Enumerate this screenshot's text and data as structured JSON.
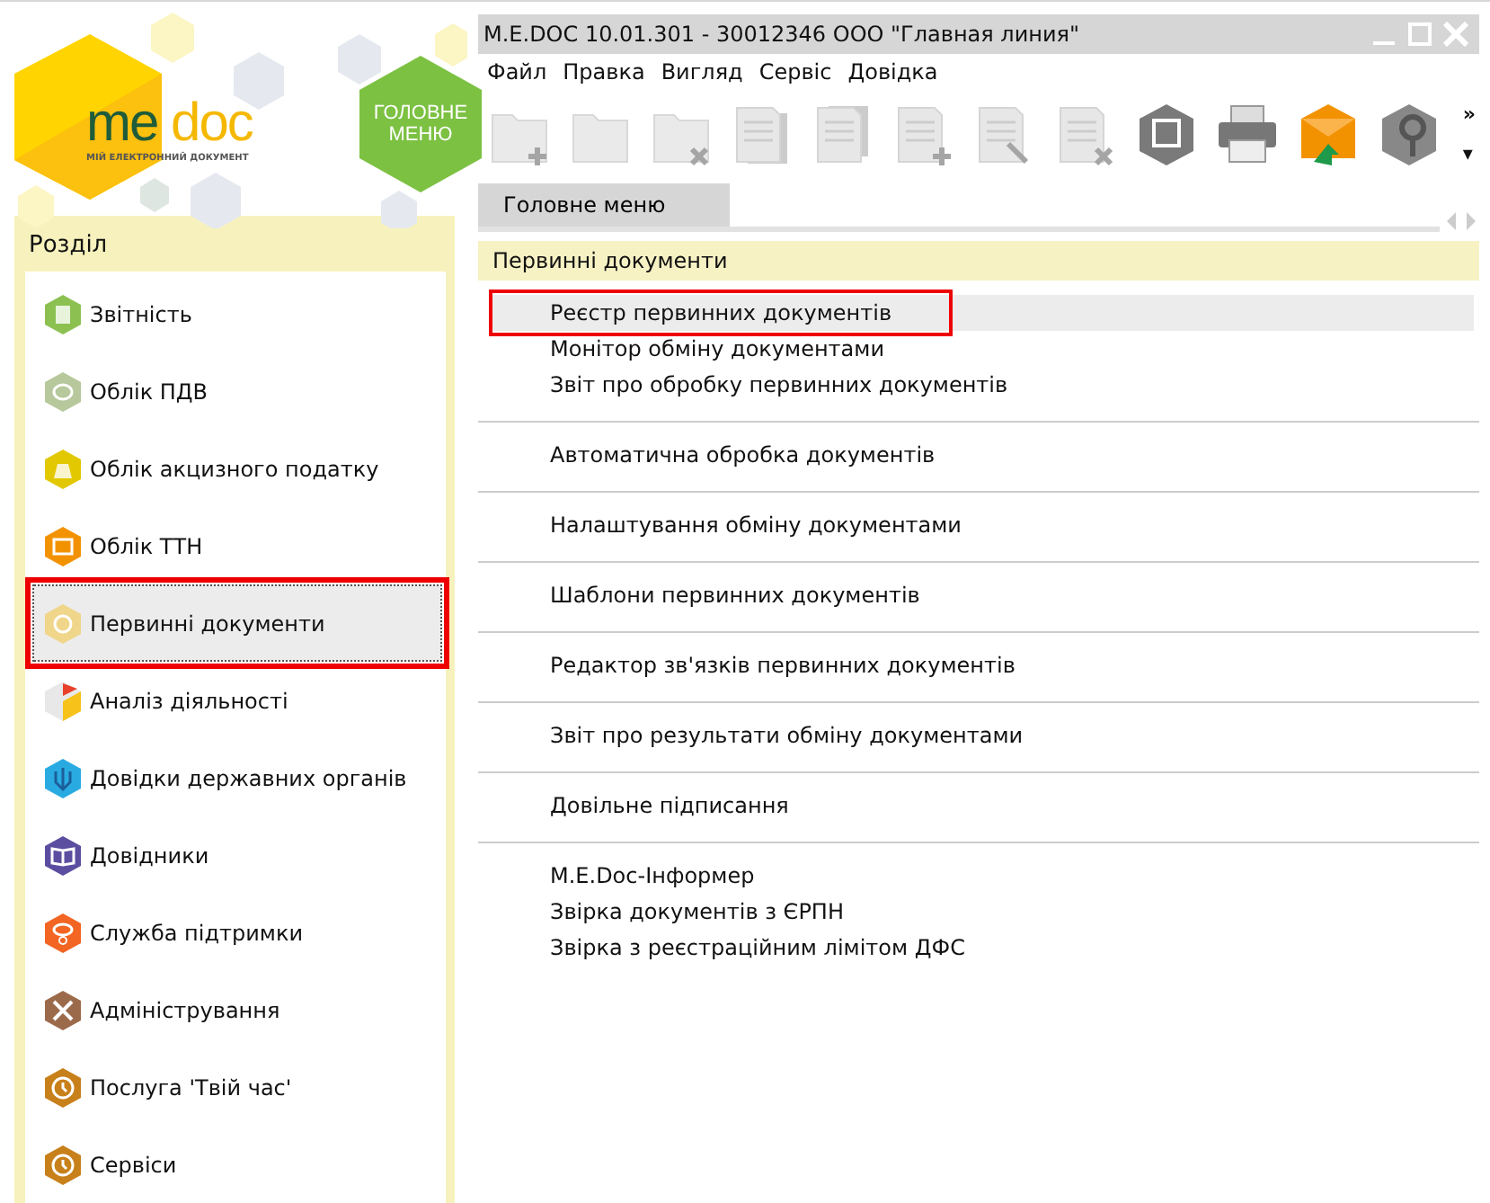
{
  "logo": {
    "name_left": "me",
    "name_right": "doc",
    "tagline": "МІЙ ЕЛЕКТРОННИЙ ДОКУМЕНТ"
  },
  "main_menu_button": {
    "label": "ГОЛОВНЕ МЕНЮ"
  },
  "sidebar": {
    "title": "Розділ",
    "items": [
      {
        "label": "Звітність",
        "color": "#8cc152",
        "selected": false,
        "highlighted": false
      },
      {
        "label": "Облік ПДВ",
        "color": "#b7c89c",
        "selected": false,
        "highlighted": false
      },
      {
        "label": "Облік акцизного податку",
        "color": "#e2c800",
        "selected": false,
        "highlighted": false
      },
      {
        "label": "Облік ТТН",
        "color": "#f39200",
        "selected": false,
        "highlighted": false
      },
      {
        "label": "Первинні документи",
        "color": "#f0d68a",
        "selected": true,
        "highlighted": true
      },
      {
        "label": "Аналіз діяльності",
        "color": "#e8e8e8",
        "selected": false,
        "highlighted": false
      },
      {
        "label": "Довідки державних органів",
        "color": "#29abe2",
        "selected": false,
        "highlighted": false
      },
      {
        "label": "Довідники",
        "color": "#5b4ea0",
        "selected": false,
        "highlighted": false
      },
      {
        "label": "Служба підтримки",
        "color": "#f26522",
        "selected": false,
        "highlighted": false
      },
      {
        "label": "Адміністрування",
        "color": "#9b6a4a",
        "selected": false,
        "highlighted": false
      },
      {
        "label": "Послуга 'Твій час'",
        "color": "#c8801a",
        "selected": false,
        "highlighted": false
      },
      {
        "label": "Сервіси",
        "color": "#c8801a",
        "selected": false,
        "highlighted": false
      }
    ]
  },
  "window": {
    "title": "M.E.DOC 10.01.301  - 30012346 ООО \"Главная линия\""
  },
  "menu": [
    "Файл",
    "Правка",
    "Вигляд",
    "Сервіс",
    "Довідка"
  ],
  "toolbar": {
    "buttons": [
      {
        "disabled": true
      },
      {
        "disabled": true
      },
      {
        "disabled": true
      },
      {
        "disabled": true
      },
      {
        "disabled": true
      },
      {
        "disabled": true
      },
      {
        "disabled": true
      },
      {
        "disabled": true
      },
      {
        "disabled": false
      },
      {
        "disabled": false
      },
      {
        "disabled": false
      },
      {
        "disabled": false
      }
    ],
    "more": "»",
    "dropdown": "▾"
  },
  "tabs": [
    {
      "label": "Головне меню",
      "selected": true
    }
  ],
  "content": {
    "title": "Первинні документи",
    "groups": [
      [
        {
          "label": "Реєстр первинних документів",
          "selected": true,
          "highlighted": true
        },
        {
          "label": "Монітор обміну документами",
          "selected": false,
          "highlighted": false
        },
        {
          "label": "Звіт про обробку первинних документів",
          "selected": false,
          "highlighted": false
        }
      ],
      [
        {
          "label": "Автоматична обробка документів",
          "selected": false,
          "highlighted": false
        }
      ],
      [
        {
          "label": "Налаштування обміну документами",
          "selected": false,
          "highlighted": false
        }
      ],
      [
        {
          "label": "Шаблони первинних документів",
          "selected": false,
          "highlighted": false
        }
      ],
      [
        {
          "label": "Редактор зв'язків первинних документів",
          "selected": false,
          "highlighted": false
        }
      ],
      [
        {
          "label": "Звіт про результати обміну документами",
          "selected": false,
          "highlighted": false
        }
      ],
      [
        {
          "label": "Довільне підписання",
          "selected": false,
          "highlighted": false
        }
      ],
      [
        {
          "label": "M.E.Doc-Інформер",
          "selected": false,
          "highlighted": false
        },
        {
          "label": "Звірка документів з ЄРПН",
          "selected": false,
          "highlighted": false
        },
        {
          "label": "Звірка з реєстраційним лімітом ДФС",
          "selected": false,
          "highlighted": false
        }
      ]
    ]
  }
}
